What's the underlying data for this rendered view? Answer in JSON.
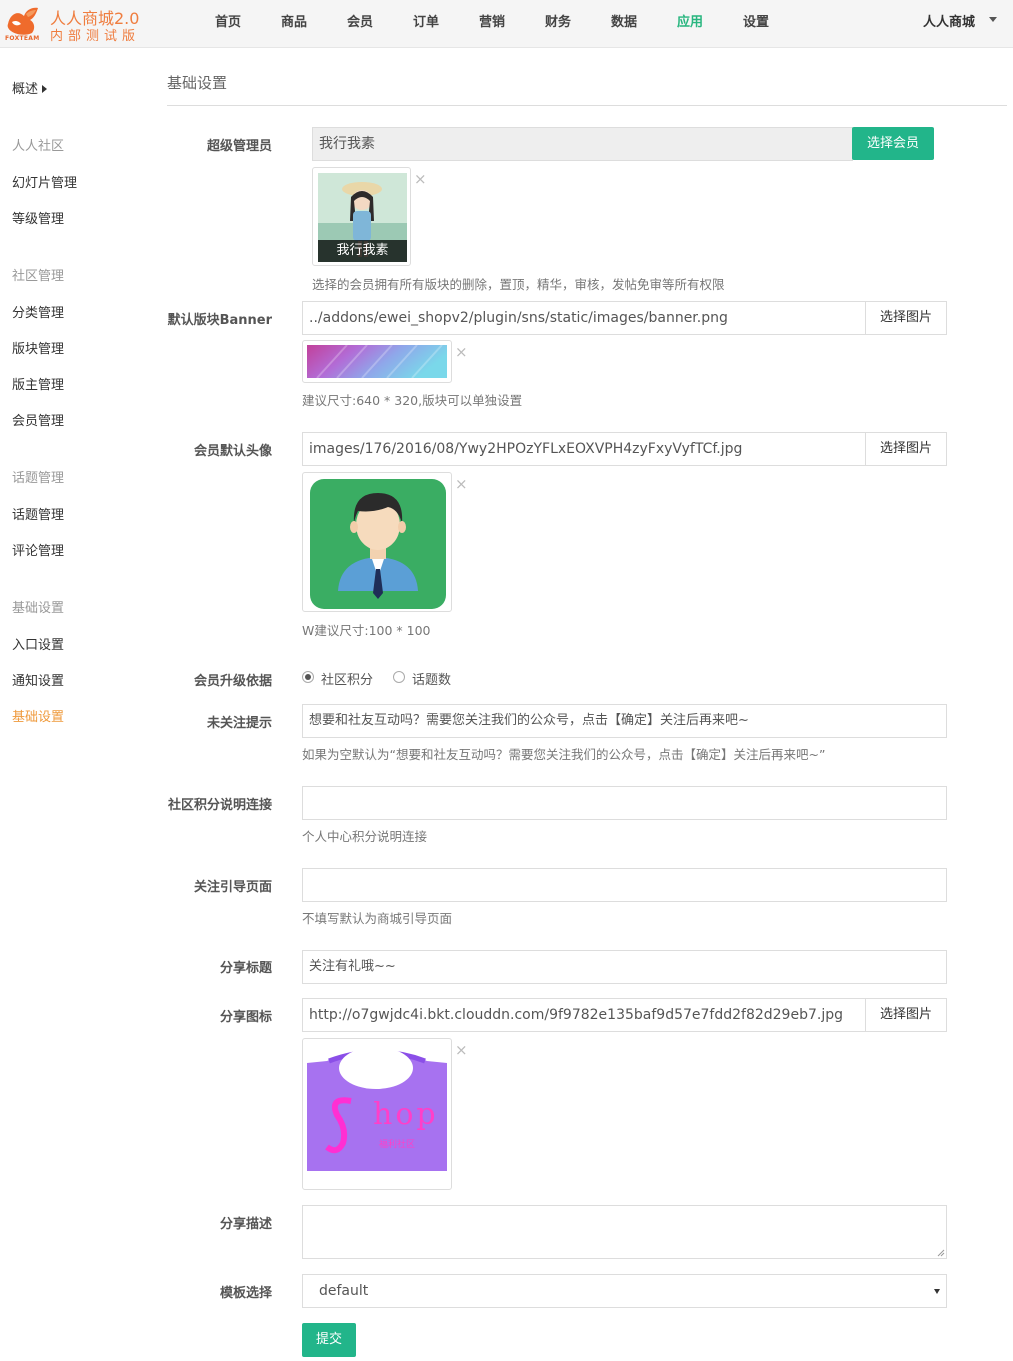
{
  "header": {
    "brand_title": "人人商城2.0",
    "brand_subtitle": "内部测试版",
    "brand_tag": "FOXTEAM",
    "nav": [
      {
        "label": "首页"
      },
      {
        "label": "商品"
      },
      {
        "label": "会员"
      },
      {
        "label": "订单"
      },
      {
        "label": "营销"
      },
      {
        "label": "财务"
      },
      {
        "label": "数据"
      },
      {
        "label": "应用",
        "active": true
      },
      {
        "label": "设置"
      }
    ],
    "shop_name": "人人商城",
    "accent_color": "#28b67f"
  },
  "sidebar": {
    "overview": "概述",
    "groups": [
      {
        "heading": "人人社区",
        "items": [
          "幻灯片管理",
          "等级管理"
        ]
      },
      {
        "heading": "社区管理",
        "items": [
          "分类管理",
          "版块管理",
          "版主管理",
          "会员管理"
        ]
      },
      {
        "heading": "话题管理",
        "items": [
          "话题管理",
          "评论管理"
        ]
      },
      {
        "heading": "基础设置",
        "items": [
          "入口设置",
          "通知设置",
          "基础设置"
        ]
      }
    ],
    "active_item": "基础设置",
    "active_color": "#ef9a3c"
  },
  "main": {
    "title": "基础设置",
    "super_admin": {
      "label": "超级管理员",
      "value": "我行我素",
      "button": "选择会员",
      "avatar_caption": "我行我素",
      "hint": "选择的会员拥有所有版块的删除，置顶，精华，审核，发帖免审等所有权限"
    },
    "banner": {
      "label": "默认版块Banner",
      "value": "../addons/ewei_shopv2/plugin/sns/static/images/banner.png",
      "button": "选择图片",
      "hint": "建议尺寸:640 * 320,版块可以单独设置"
    },
    "default_avatar": {
      "label": "会员默认头像",
      "value": "images/176/2016/08/Ywy2HPOzYFLxEOXVPH4zyFxyVyfTCf.jpg",
      "button": "选择图片",
      "hint": "W建议尺寸:100 * 100"
    },
    "upgrade_basis": {
      "label": "会员升级依据",
      "options": [
        {
          "label": "社区积分",
          "checked": true
        },
        {
          "label": "话题数",
          "checked": false
        }
      ]
    },
    "unfollow_tip": {
      "label": "未关注提示",
      "value": "想要和社友互动吗？需要您关注我们的公众号，点击【确定】关注后再来吧~",
      "hint": "如果为空默认为“想要和社友互动吗？需要您关注我们的公众号，点击【确定】关注后再来吧~”"
    },
    "credit_link": {
      "label": "社区积分说明连接",
      "value": "",
      "hint": "个人中心积分说明连接"
    },
    "follow_page": {
      "label": "关注引导页面",
      "value": "",
      "hint": "不填写默认为商城引导页面"
    },
    "share_title": {
      "label": "分享标题",
      "value": "关注有礼哦~~"
    },
    "share_icon": {
      "label": "分享图标",
      "value": "http://o7gwjdc4i.bkt.clouddn.com/9f9782e135baf9d57e7fdd2f82d29eb7.jpg",
      "button": "选择图片",
      "image_text": "hop",
      "image_small_text": "福利社区"
    },
    "share_desc": {
      "label": "分享描述",
      "value": ""
    },
    "template": {
      "label": "模板选择",
      "value": "default"
    },
    "submit": "提交",
    "close_glyph": "×"
  }
}
